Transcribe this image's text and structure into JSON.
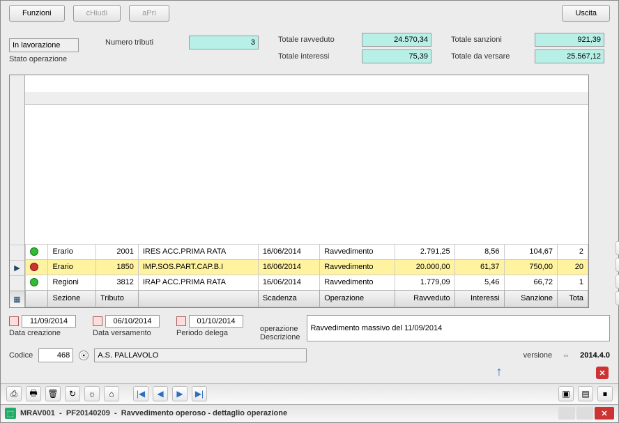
{
  "window": {
    "app_code": "MRAV001",
    "profile": "PF20140209",
    "title_rest": "Ravvedimento operoso - dettaglio operazione"
  },
  "toolbar": {
    "icons": [
      "⎙",
      "🖶",
      "🗑",
      "↻",
      "☼",
      "⌂"
    ],
    "nav": [
      "|◀",
      "◀",
      "▶",
      "▶|"
    ],
    "right": [
      "▣",
      "▤",
      "⏹"
    ]
  },
  "topform": {
    "codice_label": "Codice",
    "codice": "468",
    "codice_desc": "A.S. PALLAVOLO",
    "versione_label": "versione",
    "versione": "2014.4.0",
    "data_creazione_label": "Data creazione",
    "data_creazione": "11/09/2014",
    "data_versamento_label": "Data versamento",
    "data_versamento": "06/10/2014",
    "periodo_delega_label": "Periodo delega",
    "periodo_delega": "01/10/2014",
    "descrizione_label": "Descrizione",
    "descrizione_label2": "operazione",
    "descrizione": "Ravvedimento massivo del 11/09/2014"
  },
  "grid": {
    "headers": [
      "",
      "Sezione",
      "Tributo",
      "",
      "Scadenza",
      "Operazione",
      "Ravveduto",
      "Interessi",
      "Sanzione",
      "Tota"
    ],
    "rows": [
      {
        "dot": "green",
        "sezione": "Regioni",
        "trib_code": "3812",
        "trib_desc": "IRAP ACC.PRIMA RATA",
        "scad": "16/06/2014",
        "op": "Ravvedimento",
        "ravv": "1.779,09",
        "int": "5,46",
        "sanz": "66,72",
        "tot": "1"
      },
      {
        "dot": "red",
        "sezione": "Erario",
        "trib_code": "1850",
        "trib_desc": "IMP.SOS.PART.CAP.B.I",
        "scad": "16/06/2014",
        "op": "Ravvedimento",
        "ravv": "20.000,00",
        "int": "61,37",
        "sanz": "750,00",
        "tot": "20",
        "selected": true
      },
      {
        "dot": "green",
        "sezione": "Erario",
        "trib_code": "2001",
        "trib_desc": "IRES ACC.PRIMA RATA",
        "scad": "16/06/2014",
        "op": "Ravvedimento",
        "ravv": "2.791,25",
        "int": "8,56",
        "sanz": "104,67",
        "tot": "2"
      }
    ],
    "side_icons": [
      "✖",
      "✎",
      "☐",
      "⚑"
    ]
  },
  "totals": {
    "stato_label": "Stato operazione",
    "stato": "In lavorazione",
    "numero_label": "Numero tributi",
    "numero": "3",
    "tot_interessi_label": "Totale interessi",
    "tot_interessi": "75,39",
    "tot_ravveduto_label": "Totale ravveduto",
    "tot_ravveduto": "24.570,34",
    "tot_versare_label": "Totale da versare",
    "tot_versare": "25.567,12",
    "tot_sanzioni_label": "Totale sanzioni",
    "tot_sanzioni": "921,39"
  },
  "footer": {
    "funzioni": "Funzioni",
    "chiudi": "cHiudi",
    "aprI": "aPri",
    "uscita": "Uscita"
  }
}
